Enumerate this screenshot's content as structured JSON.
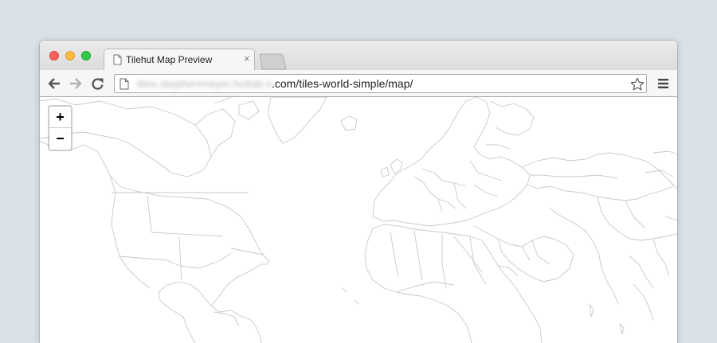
{
  "browser": {
    "tab_title": "Tilehut Map Preview",
    "tab_close": "×",
    "url_host": "tiles.stephenmeyer.hutlab.io",
    "url_path": ".com/tiles-world-simple/map/"
  },
  "map": {
    "zoom_in_label": "+",
    "zoom_out_label": "−",
    "border_color": "#c8c8c8"
  },
  "icons": [
    "back-arrow-icon",
    "forward-arrow-icon",
    "reload-icon",
    "page-icon",
    "star-icon",
    "hamburger-menu-icon"
  ]
}
